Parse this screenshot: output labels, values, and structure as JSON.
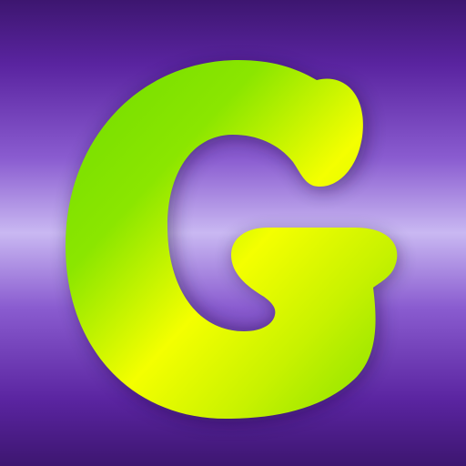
{
  "app_icon": {
    "logo_text": "G",
    "icon_name": "letter-g-logo-icon",
    "colors": {
      "background_dark": "#3d1670",
      "background_mid": "#8a5cd0",
      "background_light": "#c9b8f2",
      "letter_green": "#7fe000",
      "letter_yellow": "#f4ff00"
    }
  }
}
